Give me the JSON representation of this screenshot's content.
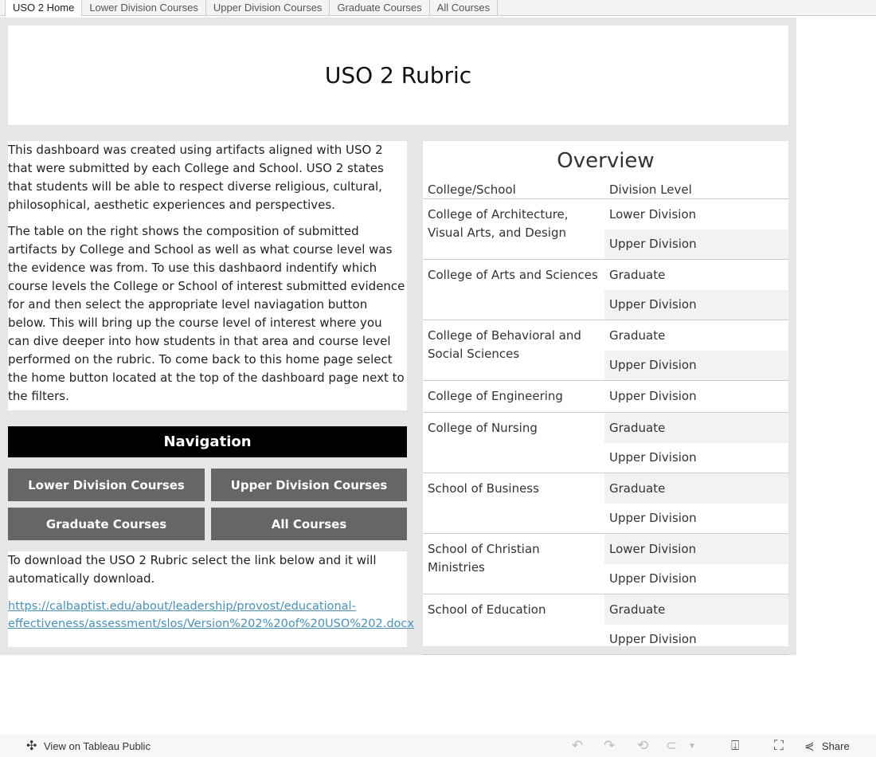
{
  "tabs": [
    "USO 2 Home",
    "Lower Division Courses",
    "Upper Division Courses",
    "Graduate Courses",
    "All Courses"
  ],
  "title": "USO 2 Rubric",
  "intro": {
    "p1": "This dashboard was created using artifacts aligned with USO 2 that were submitted by each College and School. USO 2 states that students will be able to respect diverse religious, cultural, philosophical, aesthetic experiences and perspectives.",
    "p2": "The table on the right shows the composition of submitted artifacts by College and School as well as what course level was the evidence was from.  To use this dashbaord indentify which course levels the College or School of interest submitted evidence for and then select the appropriate level naviagation button below. This will bring up the course level of interest where you can dive deeper into how students in that area and course level performed on the rubric. To come back to this home page select the home button located  at the top of the dashboard page next to the filters."
  },
  "navigation": {
    "title": "Navigation",
    "lower": "Lower Division Courses",
    "upper": "Upper Division Courses",
    "graduate": "Graduate Courses",
    "all": "All Courses"
  },
  "download": {
    "text": "To download the USO 2 Rubric select the link below and it will automatically download.",
    "link": "https://calbaptist.edu/about/leadership/provost/educational-effectiveness/assessment/slos/Version%202%20of%20USO%202.docx"
  },
  "overview": {
    "title": "Overview",
    "col1": "College/School",
    "col2": "Division Level",
    "groups": [
      {
        "name": "College of Architecture, Visual Arts, and Design",
        "levels": [
          "Lower Division",
          "Upper Division"
        ]
      },
      {
        "name": "College of Arts and Sciences",
        "levels": [
          "Graduate",
          "Upper Division"
        ]
      },
      {
        "name": "College of Behavioral and Social Sciences",
        "levels": [
          "Graduate",
          "Upper Division"
        ]
      },
      {
        "name": "College of Engineering",
        "levels": [
          "Upper Division"
        ]
      },
      {
        "name": "College of Nursing",
        "levels": [
          "Graduate",
          "Upper Division"
        ]
      },
      {
        "name": "School of Business",
        "levels": [
          "Graduate",
          "Upper Division"
        ]
      },
      {
        "name": "School of Christian Ministries",
        "levels": [
          "Lower Division",
          "Upper Division"
        ]
      },
      {
        "name": "School of Education",
        "levels": [
          "Graduate",
          "Upper Division"
        ]
      }
    ]
  },
  "footer": {
    "view": "View on Tableau Public",
    "share": "Share"
  }
}
